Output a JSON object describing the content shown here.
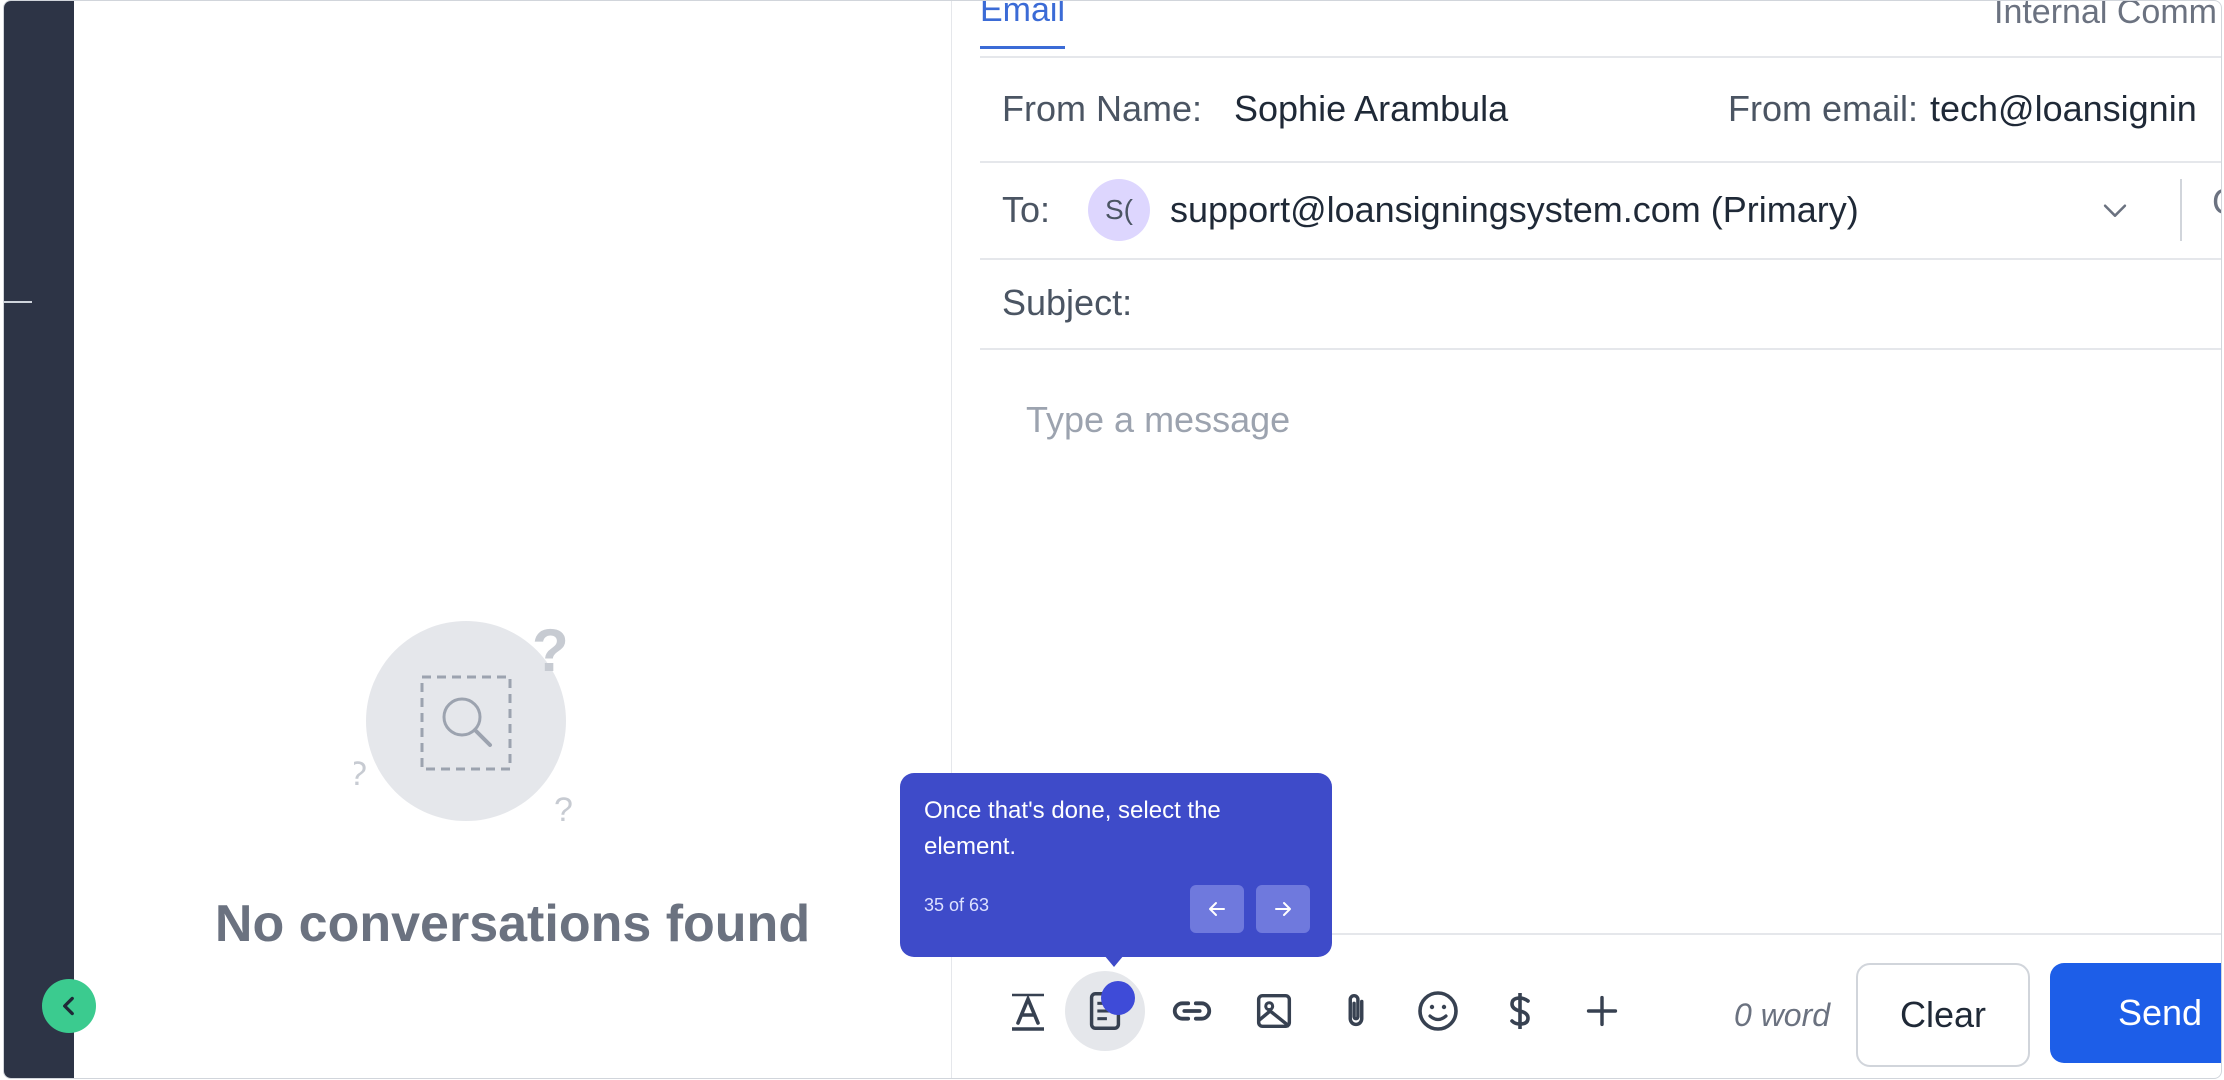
{
  "left_pane": {
    "empty_title": "No conversations found"
  },
  "tabs": {
    "email": "Email",
    "internal": "Internal Comm"
  },
  "compose": {
    "from_name_label": "From Name:",
    "from_name_value": "Sophie Arambula",
    "from_email_label": "From email:",
    "from_email_value": "tech@loansignin",
    "to_label": "To:",
    "to_avatar": "S(",
    "to_value": "support@loansigningsystem.com (Primary)",
    "cc_cut": "C",
    "subject_label": "Subject:",
    "message_placeholder": "Type a message"
  },
  "toolbar": {
    "icons": [
      "text-format-icon",
      "template-icon",
      "link-icon",
      "image-icon",
      "attachment-icon",
      "emoji-icon",
      "dollar-icon",
      "plus-icon"
    ],
    "word_count": "0 word",
    "clear_label": "Clear",
    "send_label": "Send"
  },
  "tooltip": {
    "text": "Once that's done, select the element.",
    "progress": "35 of 63"
  },
  "colors": {
    "accent": "#3b6bd6",
    "send": "#1d5ee8",
    "tooltip": "#3e4bc9",
    "sidebar": "#2d3446",
    "collapse": "#3bcb8f"
  }
}
